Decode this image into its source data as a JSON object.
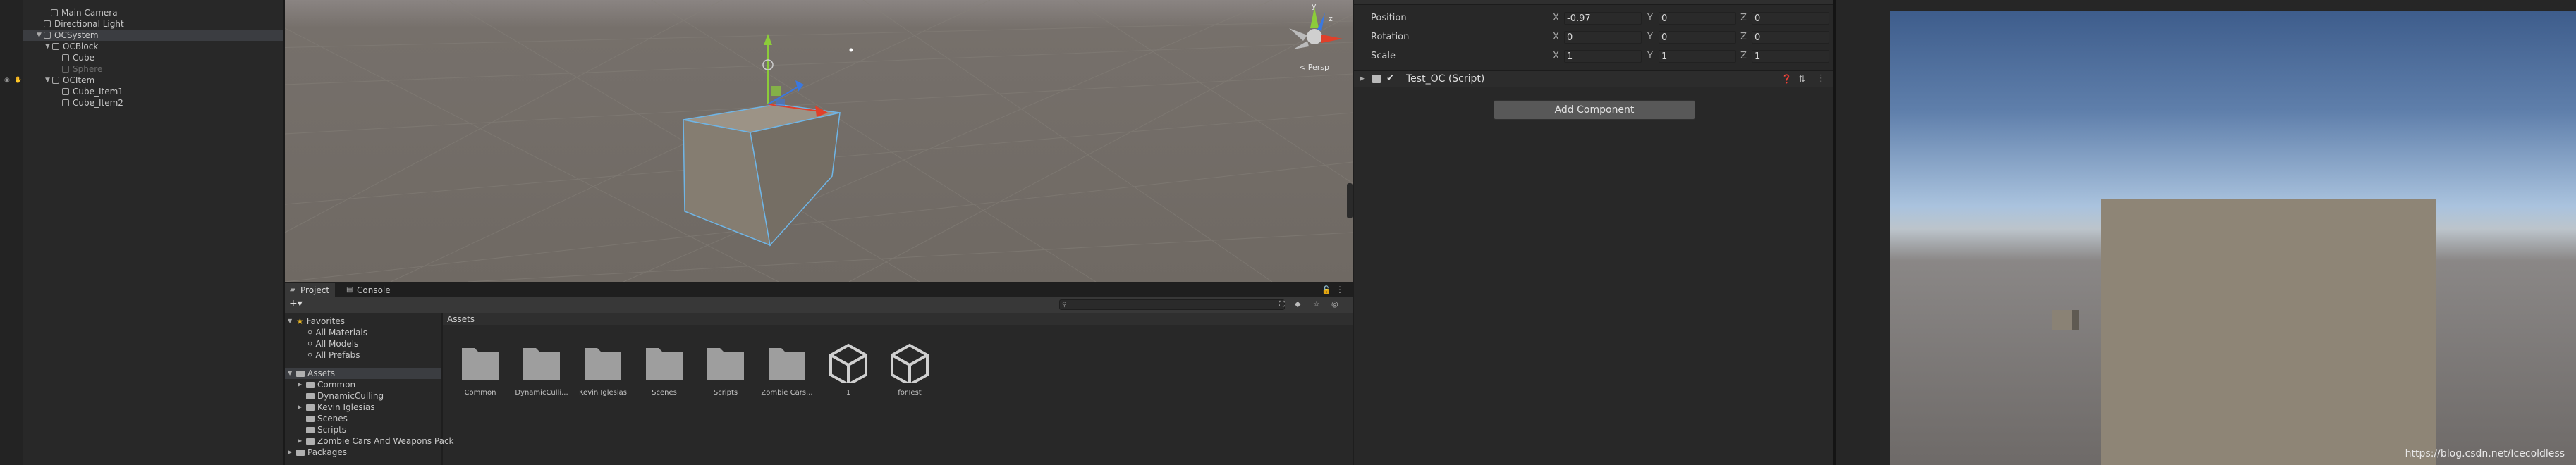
{
  "hierarchy": {
    "items": [
      {
        "label": "Main Camera"
      },
      {
        "label": "Directional Light"
      },
      {
        "label": "OCSystem"
      },
      {
        "label": "OCBlock"
      },
      {
        "label": "Cube"
      },
      {
        "label": "Sphere"
      },
      {
        "label": "OCItem"
      },
      {
        "label": "Cube_Item1"
      },
      {
        "label": "Cube_Item2"
      }
    ]
  },
  "scene": {
    "persp_label": "< Persp",
    "gizmo_labels": {
      "y": "y",
      "z": "z"
    }
  },
  "project": {
    "tabs": [
      {
        "label": "Project"
      },
      {
        "label": "Console"
      }
    ],
    "favorites": {
      "label": "Favorites",
      "items": [
        {
          "label": "All Materials"
        },
        {
          "label": "All Models"
        },
        {
          "label": "All Prefabs"
        }
      ]
    },
    "assets_root": "Assets",
    "asset_folders": [
      {
        "label": "Common"
      },
      {
        "label": "DynamicCulling"
      },
      {
        "label": "Kevin Iglesias"
      },
      {
        "label": "Scenes"
      },
      {
        "label": "Scripts"
      },
      {
        "label": "Zombie Cars And Weapons Pack"
      }
    ],
    "packages_label": "Packages",
    "breadcrumb": "Assets",
    "grid_items": [
      {
        "label": "Common",
        "kind": "folder"
      },
      {
        "label": "DynamicCulli...",
        "kind": "folder"
      },
      {
        "label": "Kevin Iglesias",
        "kind": "folder"
      },
      {
        "label": "Scenes",
        "kind": "folder"
      },
      {
        "label": "Scripts",
        "kind": "folder"
      },
      {
        "label": "Zombie Cars...",
        "kind": "folder"
      },
      {
        "label": "1",
        "kind": "unity-scene"
      },
      {
        "label": "forTest",
        "kind": "unity-scene"
      }
    ]
  },
  "inspector": {
    "transform": {
      "position": {
        "label": "Position",
        "x": "-0.97",
        "y": "0",
        "z": "0"
      },
      "rotation": {
        "label": "Rotation",
        "x": "0",
        "y": "0",
        "z": "0"
      },
      "scale": {
        "label": "Scale",
        "x": "1",
        "y": "1",
        "z": "1"
      }
    },
    "axis": {
      "x": "X",
      "y": "Y",
      "z": "Z"
    },
    "component": {
      "label": "Test_OC (Script)",
      "enabled": true
    },
    "add_component_label": "Add Component"
  },
  "game": {
    "watermark": "https://blog.csdn.net/Icecoldless"
  },
  "colors": {
    "selection": "#3b3d41",
    "gizmo_x": "#e0402a",
    "gizmo_y": "#8ccc3a",
    "gizmo_z": "#3a78e0",
    "cube_face": "#8d8579",
    "sky_top": "#3e5d8c"
  }
}
